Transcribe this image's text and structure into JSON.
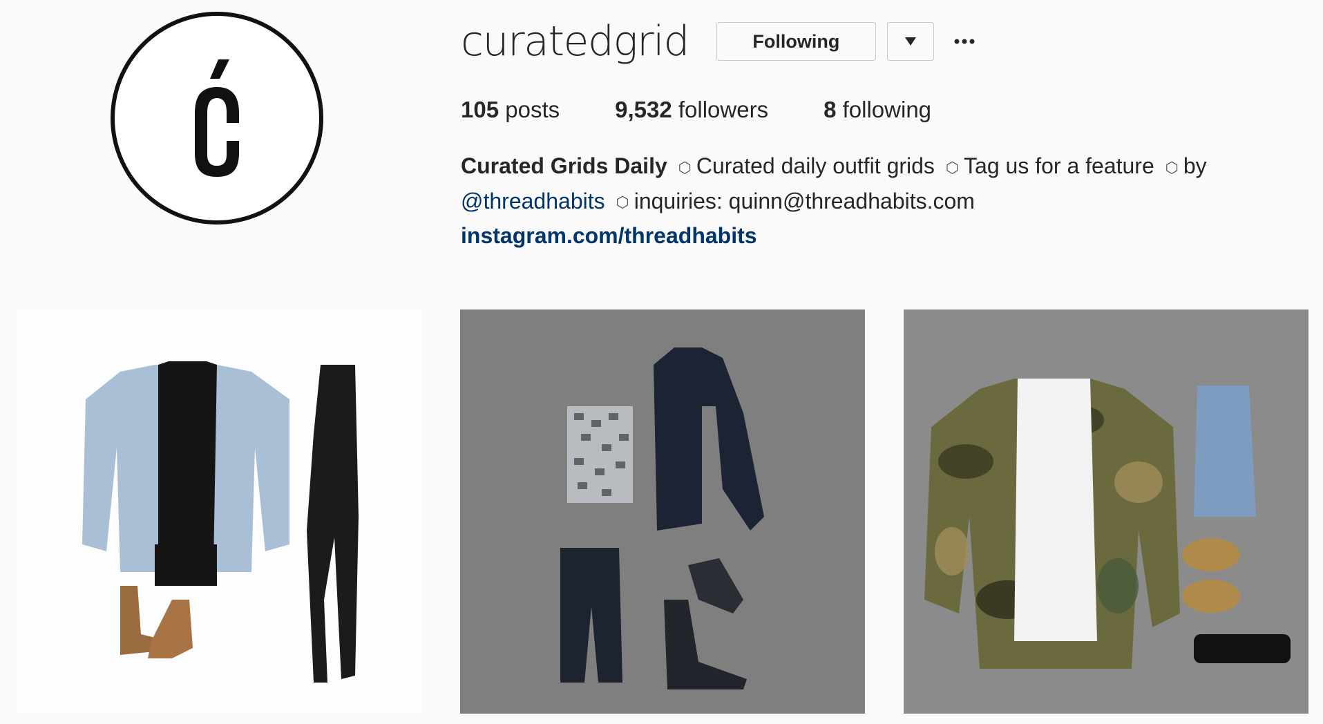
{
  "profile": {
    "username": "curatedgrid",
    "follow_button": "Following"
  },
  "stats": {
    "posts_count": "105",
    "posts_label": "posts",
    "followers_count": "9,532",
    "followers_label": "followers",
    "following_count": "8",
    "following_label": "following"
  },
  "bio": {
    "name": "Curated Grids Daily",
    "separator": "⬡",
    "part1": "Curated daily outfit grids",
    "part2": "Tag us for a feature",
    "part3": "by",
    "handle": "@threadhabits",
    "inquiries": "inquiries: quinn@threadhabits.com",
    "link": "instagram.com/threadhabits"
  },
  "icons": {
    "avatar": "logo-c-acute",
    "dropdown": "caret-down-icon",
    "more": "ellipsis-icon"
  },
  "colors": {
    "background": "#fafafa",
    "text": "#262626",
    "link": "#003569",
    "border": "#c8c8c8"
  }
}
